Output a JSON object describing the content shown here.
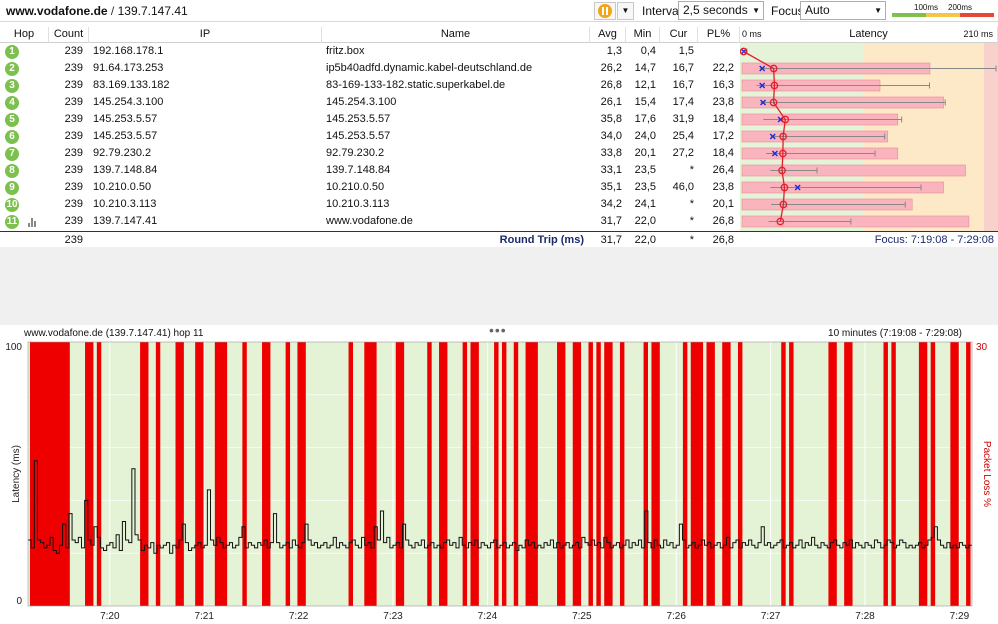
{
  "toolbar": {
    "target_host": "www.vodafone.de",
    "separator": "/",
    "target_ip": "139.7.147.41",
    "interval_label": "Interval",
    "interval_value": "2,5 seconds",
    "focus_label": "Focus",
    "focus_value": "Auto",
    "scale_labels": [
      "100ms",
      "200ms"
    ],
    "scale_colors": [
      "#7cc14e",
      "#f3c64b",
      "#e8453c"
    ]
  },
  "table": {
    "columns": [
      "Hop",
      "Count",
      "IP",
      "Name",
      "Avg",
      "Min",
      "Cur",
      "PL%",
      "Latency"
    ],
    "latency_min_label": "0 ms",
    "latency_max_label": "210 ms",
    "rows": [
      {
        "hop": "1",
        "count": "239",
        "ip": "192.168.178.1",
        "name": "fritz.box",
        "avg": "1,3",
        "min": "0,4",
        "cur": "1,5",
        "pl": "",
        "avg_v": 1.3,
        "min_v": 0.4,
        "cur_v": 1.5,
        "max_v": 4,
        "pl_v": 0
      },
      {
        "hop": "2",
        "count": "239",
        "ip": "91.64.173.253",
        "name": "ip5b40adfd.dynamic.kabel-deutschland.de",
        "avg": "26,2",
        "min": "14,7",
        "cur": "16,7",
        "pl": "22,2",
        "avg_v": 26.2,
        "min_v": 14.7,
        "cur_v": 16.7,
        "max_v": 210,
        "pl_v": 22.2
      },
      {
        "hop": "3",
        "count": "239",
        "ip": "83.169.133.182",
        "name": "83-169-133-182.static.superkabel.de",
        "avg": "26,8",
        "min": "12,1",
        "cur": "16,7",
        "pl": "16,3",
        "avg_v": 26.8,
        "min_v": 12.1,
        "cur_v": 16.7,
        "max_v": 155,
        "pl_v": 16.3
      },
      {
        "hop": "4",
        "count": "239",
        "ip": "145.254.3.100",
        "name": "145.254.3.100",
        "avg": "26,1",
        "min": "15,4",
        "cur": "17,4",
        "pl": "23,8",
        "avg_v": 26.1,
        "min_v": 15.4,
        "cur_v": 17.4,
        "max_v": 168,
        "pl_v": 23.8
      },
      {
        "hop": "5",
        "count": "239",
        "ip": "145.253.5.57",
        "name": "145.253.5.57",
        "avg": "35,8",
        "min": "17,6",
        "cur": "31,9",
        "pl": "18,4",
        "avg_v": 35.8,
        "min_v": 17.6,
        "cur_v": 31.9,
        "max_v": 132,
        "pl_v": 18.4
      },
      {
        "hop": "6",
        "count": "239",
        "ip": "145.253.5.57",
        "name": "145.253.5.57",
        "avg": "34,0",
        "min": "24,0",
        "cur": "25,4",
        "pl": "17,2",
        "avg_v": 34.0,
        "min_v": 24.0,
        "cur_v": 25.4,
        "max_v": 118,
        "pl_v": 17.2
      },
      {
        "hop": "7",
        "count": "239",
        "ip": "92.79.230.2",
        "name": "92.79.230.2",
        "avg": "33,8",
        "min": "20,1",
        "cur": "27,2",
        "pl": "18,4",
        "avg_v": 33.8,
        "min_v": 20.1,
        "cur_v": 27.2,
        "max_v": 110,
        "pl_v": 18.4
      },
      {
        "hop": "8",
        "count": "239",
        "ip": "139.7.148.84",
        "name": "139.7.148.84",
        "avg": "33,1",
        "min": "23,5",
        "cur": "*",
        "pl": "26,4",
        "avg_v": 33.1,
        "min_v": 23.5,
        "cur_v": null,
        "max_v": 62,
        "pl_v": 26.4
      },
      {
        "hop": "9",
        "count": "239",
        "ip": "10.210.0.50",
        "name": "10.210.0.50",
        "avg": "35,1",
        "min": "23,5",
        "cur": "46,0",
        "pl": "23,8",
        "avg_v": 35.1,
        "min_v": 23.5,
        "cur_v": 46.0,
        "max_v": 148,
        "pl_v": 23.8
      },
      {
        "hop": "10",
        "count": "239",
        "ip": "10.210.3.113",
        "name": "10.210.3.113",
        "avg": "34,2",
        "min": "24,1",
        "cur": "*",
        "pl": "20,1",
        "avg_v": 34.2,
        "min_v": 24.1,
        "cur_v": null,
        "max_v": 135,
        "pl_v": 20.1
      },
      {
        "hop": "11",
        "count": "239",
        "ip": "139.7.147.41",
        "name": "www.vodafone.de",
        "avg": "31,7",
        "min": "22,0",
        "cur": "*",
        "pl": "26,8",
        "avg_v": 31.7,
        "min_v": 22.0,
        "cur_v": null,
        "max_v": 90,
        "pl_v": 26.8
      }
    ],
    "total": {
      "count": "239",
      "label": "Round Trip (ms)",
      "avg": "31,7",
      "min": "22,0",
      "cur": "*",
      "pl": "26,8",
      "focus": "Focus: 7:19:08 - 7:29:08"
    }
  },
  "graph": {
    "title": "www.vodafone.de (139.7.147.41) hop 11",
    "range": "10 minutes (7:19:08 - 7:29:08)",
    "ylabel": "Latency (ms)",
    "y2label": "Packet Loss %",
    "ymax_label": "100",
    "ymin_label": "0",
    "y2max_label": "30",
    "colors": {
      "background": "#e4f2d6",
      "loss": "#ee0000",
      "line": "#111111",
      "grid": "#ffffff"
    }
  },
  "chart_data": {
    "type": "line",
    "title": "www.vodafone.de (139.7.147.41) hop 11",
    "xlabel": "",
    "ylabel": "Latency (ms)",
    "y2label": "Packet Loss %",
    "ylim": [
      0,
      100
    ],
    "y2lim": [
      0,
      30
    ],
    "xlim_seconds": [
      0,
      600
    ],
    "x_ticks": [
      {
        "label": "7:20",
        "t": 52
      },
      {
        "label": "7:21",
        "t": 112
      },
      {
        "label": "7:22",
        "t": 172
      },
      {
        "label": "7:23",
        "t": 232
      },
      {
        "label": "7:24",
        "t": 292
      },
      {
        "label": "7:25",
        "t": 352
      },
      {
        "label": "7:26",
        "t": 412
      },
      {
        "label": "7:27",
        "t": 472
      },
      {
        "label": "7:28",
        "t": 532
      },
      {
        "label": "7:29",
        "t": 592
      }
    ],
    "latency": [
      [
        0,
        25
      ],
      [
        2,
        22
      ],
      [
        4,
        55
      ],
      [
        6,
        25
      ],
      [
        8,
        24
      ],
      [
        10,
        22
      ],
      [
        12,
        23
      ],
      [
        14,
        26
      ],
      [
        16,
        21
      ],
      [
        18,
        20
      ],
      [
        20,
        23
      ],
      [
        22,
        31
      ],
      [
        24,
        22
      ],
      [
        26,
        35
      ],
      [
        28,
        25
      ],
      [
        30,
        24
      ],
      [
        32,
        26
      ],
      [
        34,
        22
      ],
      [
        36,
        40
      ],
      [
        38,
        25
      ],
      [
        40,
        23
      ],
      [
        42,
        30
      ],
      [
        44,
        26
      ],
      [
        46,
        22
      ],
      [
        48,
        21
      ],
      [
        50,
        23
      ],
      [
        52,
        24
      ],
      [
        54,
        22
      ],
      [
        56,
        27
      ],
      [
        58,
        21
      ],
      [
        60,
        32
      ],
      [
        62,
        25
      ],
      [
        64,
        24
      ],
      [
        66,
        52
      ],
      [
        68,
        27
      ],
      [
        70,
        25
      ],
      [
        72,
        21
      ],
      [
        74,
        23
      ],
      [
        76,
        22
      ],
      [
        78,
        24
      ],
      [
        80,
        20
      ],
      [
        82,
        23
      ],
      [
        84,
        22
      ],
      [
        86,
        23
      ],
      [
        88,
        24
      ],
      [
        90,
        20
      ],
      [
        92,
        23
      ],
      [
        94,
        22
      ],
      [
        96,
        25
      ],
      [
        98,
        31
      ],
      [
        100,
        24
      ],
      [
        102,
        21
      ],
      [
        104,
        22
      ],
      [
        106,
        23
      ],
      [
        108,
        24
      ],
      [
        110,
        22
      ],
      [
        112,
        23
      ],
      [
        114,
        44
      ],
      [
        116,
        25
      ],
      [
        118,
        23
      ],
      [
        120,
        26
      ],
      [
        122,
        24
      ],
      [
        124,
        22
      ],
      [
        126,
        23
      ],
      [
        128,
        24
      ],
      [
        130,
        22
      ],
      [
        132,
        23
      ],
      [
        134,
        26
      ],
      [
        136,
        30
      ],
      [
        138,
        22
      ],
      [
        140,
        24
      ],
      [
        142,
        23
      ],
      [
        144,
        22
      ],
      [
        146,
        24
      ],
      [
        148,
        23
      ],
      [
        150,
        25
      ],
      [
        152,
        22
      ],
      [
        154,
        24
      ],
      [
        156,
        35
      ],
      [
        158,
        24
      ],
      [
        160,
        22
      ],
      [
        162,
        23
      ],
      [
        164,
        24
      ],
      [
        166,
        22
      ],
      [
        168,
        25
      ],
      [
        170,
        23
      ],
      [
        172,
        22
      ],
      [
        174,
        24
      ],
      [
        176,
        31
      ],
      [
        178,
        25
      ],
      [
        180,
        23
      ],
      [
        182,
        24
      ],
      [
        184,
        22
      ],
      [
        186,
        23
      ],
      [
        188,
        24
      ],
      [
        190,
        22
      ],
      [
        192,
        23
      ],
      [
        194,
        26
      ],
      [
        196,
        22
      ],
      [
        198,
        24
      ],
      [
        200,
        23
      ],
      [
        202,
        22
      ],
      [
        204,
        24
      ],
      [
        206,
        25
      ],
      [
        208,
        23
      ],
      [
        210,
        22
      ],
      [
        212,
        26
      ],
      [
        214,
        23
      ],
      [
        216,
        24
      ],
      [
        218,
        22
      ],
      [
        220,
        30
      ],
      [
        222,
        25
      ],
      [
        224,
        36
      ],
      [
        226,
        24
      ],
      [
        228,
        26
      ],
      [
        230,
        22
      ],
      [
        232,
        23
      ],
      [
        234,
        24
      ],
      [
        236,
        22
      ],
      [
        238,
        31
      ],
      [
        240,
        25
      ],
      [
        242,
        23
      ],
      [
        244,
        22
      ],
      [
        246,
        24
      ],
      [
        248,
        23
      ],
      [
        250,
        25
      ],
      [
        252,
        22
      ],
      [
        254,
        23
      ],
      [
        256,
        24
      ],
      [
        258,
        22
      ],
      [
        260,
        23
      ],
      [
        262,
        22
      ],
      [
        264,
        24
      ],
      [
        266,
        25
      ],
      [
        268,
        23
      ],
      [
        270,
        24
      ],
      [
        272,
        22
      ],
      [
        274,
        26
      ],
      [
        276,
        23
      ],
      [
        278,
        22
      ],
      [
        280,
        24
      ],
      [
        282,
        23
      ],
      [
        284,
        25
      ],
      [
        286,
        22
      ],
      [
        288,
        24
      ],
      [
        290,
        23
      ],
      [
        292,
        22
      ],
      [
        294,
        24
      ],
      [
        296,
        25
      ],
      [
        298,
        22
      ],
      [
        300,
        23
      ],
      [
        302,
        24
      ],
      [
        304,
        22
      ],
      [
        306,
        23
      ],
      [
        308,
        24
      ],
      [
        310,
        21
      ],
      [
        312,
        23
      ],
      [
        314,
        22
      ],
      [
        316,
        25
      ],
      [
        318,
        23
      ],
      [
        320,
        24
      ],
      [
        322,
        22
      ],
      [
        324,
        23
      ],
      [
        326,
        22
      ],
      [
        328,
        24
      ],
      [
        330,
        23
      ],
      [
        332,
        25
      ],
      [
        334,
        22
      ],
      [
        336,
        24
      ],
      [
        338,
        22
      ],
      [
        340,
        23
      ],
      [
        342,
        24
      ],
      [
        344,
        22
      ],
      [
        346,
        23
      ],
      [
        348,
        24
      ],
      [
        350,
        22
      ],
      [
        352,
        26
      ],
      [
        354,
        24
      ],
      [
        356,
        23
      ],
      [
        358,
        25
      ],
      [
        360,
        23
      ],
      [
        362,
        24
      ],
      [
        364,
        22
      ],
      [
        366,
        26
      ],
      [
        368,
        24
      ],
      [
        370,
        22
      ],
      [
        372,
        23
      ],
      [
        374,
        24
      ],
      [
        376,
        22
      ],
      [
        378,
        23
      ],
      [
        380,
        25
      ],
      [
        382,
        22
      ],
      [
        384,
        24
      ],
      [
        386,
        23
      ],
      [
        388,
        25
      ],
      [
        390,
        22
      ],
      [
        392,
        36
      ],
      [
        394,
        24
      ],
      [
        396,
        22
      ],
      [
        398,
        25
      ],
      [
        400,
        23
      ],
      [
        402,
        22
      ],
      [
        404,
        25
      ],
      [
        406,
        23
      ],
      [
        408,
        24
      ],
      [
        410,
        22
      ],
      [
        412,
        23
      ],
      [
        414,
        31
      ],
      [
        416,
        25
      ],
      [
        418,
        22
      ],
      [
        420,
        23
      ],
      [
        422,
        24
      ],
      [
        424,
        22
      ],
      [
        426,
        23
      ],
      [
        428,
        25
      ],
      [
        430,
        23
      ],
      [
        432,
        24
      ],
      [
        434,
        22
      ],
      [
        436,
        23
      ],
      [
        438,
        24
      ],
      [
        440,
        22
      ],
      [
        442,
        23
      ],
      [
        444,
        26
      ],
      [
        446,
        22
      ],
      [
        448,
        24
      ],
      [
        450,
        25
      ],
      [
        452,
        22
      ],
      [
        454,
        24
      ],
      [
        456,
        23
      ],
      [
        458,
        25
      ],
      [
        460,
        23
      ],
      [
        462,
        22
      ],
      [
        464,
        24
      ],
      [
        466,
        30
      ],
      [
        468,
        23
      ],
      [
        470,
        24
      ],
      [
        472,
        22
      ],
      [
        474,
        23
      ],
      [
        476,
        24
      ],
      [
        478,
        25
      ],
      [
        480,
        22
      ],
      [
        482,
        23
      ],
      [
        484,
        24
      ],
      [
        486,
        22
      ],
      [
        488,
        23
      ],
      [
        490,
        25
      ],
      [
        492,
        22
      ],
      [
        494,
        24
      ],
      [
        496,
        23
      ],
      [
        498,
        26
      ],
      [
        500,
        23
      ],
      [
        502,
        22
      ],
      [
        504,
        24
      ],
      [
        506,
        23
      ],
      [
        508,
        22
      ],
      [
        510,
        24
      ],
      [
        512,
        25
      ],
      [
        514,
        23
      ],
      [
        516,
        22
      ],
      [
        518,
        24
      ],
      [
        520,
        23
      ],
      [
        522,
        25
      ],
      [
        524,
        22
      ],
      [
        526,
        24
      ],
      [
        528,
        23
      ],
      [
        530,
        22
      ],
      [
        532,
        24
      ],
      [
        534,
        23
      ],
      [
        536,
        22
      ],
      [
        538,
        25
      ],
      [
        540,
        24
      ],
      [
        542,
        22
      ],
      [
        544,
        23
      ],
      [
        546,
        25
      ],
      [
        548,
        24
      ],
      [
        550,
        22
      ],
      [
        552,
        23
      ],
      [
        554,
        25
      ],
      [
        556,
        24
      ],
      [
        558,
        22
      ],
      [
        560,
        23
      ],
      [
        562,
        22
      ],
      [
        564,
        23
      ],
      [
        566,
        24
      ],
      [
        568,
        22
      ],
      [
        570,
        23
      ],
      [
        572,
        25
      ],
      [
        574,
        26
      ],
      [
        576,
        30
      ],
      [
        578,
        25
      ],
      [
        580,
        23
      ],
      [
        582,
        22
      ],
      [
        584,
        24
      ],
      [
        586,
        22
      ],
      [
        588,
        23
      ],
      [
        590,
        22
      ],
      [
        592,
        24
      ],
      [
        594,
        23
      ],
      [
        596,
        22
      ],
      [
        598,
        23
      ]
    ],
    "loss_events_seconds": [
      2.5,
      5,
      7.5,
      10,
      12.5,
      15,
      17.5,
      20,
      22.5,
      25,
      37.5,
      40,
      45,
      72.5,
      75,
      82.5,
      95,
      97.5,
      107.5,
      110,
      120,
      122.5,
      125,
      137.5,
      150,
      152.5,
      165,
      172.5,
      175,
      205,
      215,
      217.5,
      220,
      235,
      237.5,
      255,
      262.5,
      265,
      277.5,
      282.5,
      285,
      297.5,
      302.5,
      310,
      317.5,
      320,
      322.5,
      337.5,
      340,
      347.5,
      350,
      357.5,
      362.5,
      367.5,
      370,
      377.5,
      392.5,
      397.5,
      400,
      417.5,
      422.5,
      425,
      427.5,
      432.5,
      435,
      442.5,
      445,
      452.5,
      480,
      485,
      510,
      512.5,
      520,
      522.5,
      545,
      550,
      567.5,
      570,
      575,
      587.5,
      590,
      597.5
    ]
  }
}
